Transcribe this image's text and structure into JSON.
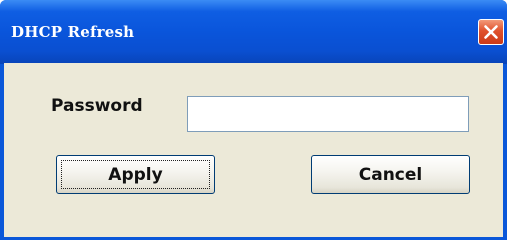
{
  "window": {
    "title": "DHCP Refresh",
    "close_icon": "close-icon"
  },
  "form": {
    "password_label": "Password",
    "password_value": "",
    "password_placeholder": ""
  },
  "buttons": {
    "apply_label": "Apply",
    "cancel_label": "Cancel"
  },
  "colors": {
    "titlebar": "#0a55db",
    "close_button": "#e0512c",
    "dialog_background": "#ece9d8"
  }
}
